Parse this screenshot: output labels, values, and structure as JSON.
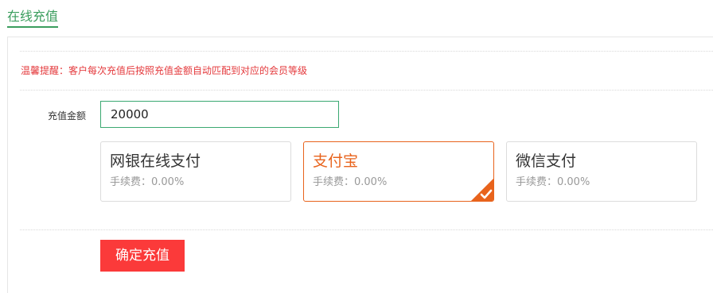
{
  "tab": {
    "title": "在线充值"
  },
  "notice": {
    "text": "温馨提醒：客户每次充值后按照充值金额自动匹配到对应的会员等级"
  },
  "amount": {
    "label": "充值金额",
    "value": "20000"
  },
  "payment_methods": [
    {
      "name": "网银在线支付",
      "fee": "手续费：0.00%",
      "selected": false
    },
    {
      "name": "支付宝",
      "fee": "手续费：0.00%",
      "selected": true
    },
    {
      "name": "微信支付",
      "fee": "手续费：0.00%",
      "selected": false
    }
  ],
  "confirm": {
    "label": "确定充值"
  },
  "icons": {
    "selected_badge": "checkmark-corner-icon"
  },
  "colors": {
    "accent_green": "#3a9d5d",
    "notice_red": "#e4393c",
    "selected_orange": "#e8631c",
    "button_red": "#fb3a3a"
  }
}
